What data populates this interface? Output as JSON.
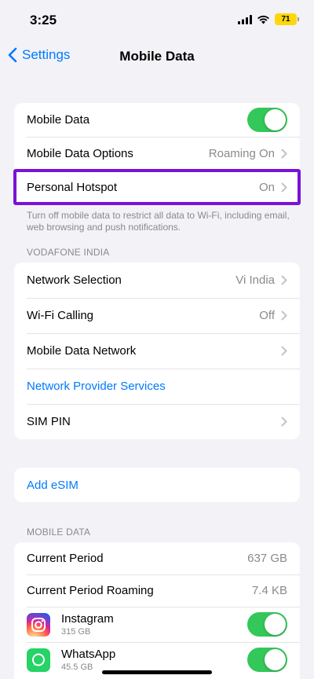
{
  "status": {
    "time": "3:25",
    "battery": "71"
  },
  "nav": {
    "back_label": "Settings",
    "title": "Mobile Data"
  },
  "group1": {
    "mobile_data_label": "Mobile Data",
    "options_label": "Mobile Data Options",
    "options_value": "Roaming On",
    "hotspot_label": "Personal Hotspot",
    "hotspot_value": "On"
  },
  "footnote": "Turn off mobile data to restrict all data to Wi-Fi, including email, web browsing and push notifications.",
  "carrier_header": "VODAFONE INDIA",
  "group2": {
    "network_selection_label": "Network Selection",
    "network_selection_value": "Vi India",
    "wifi_calling_label": "Wi-Fi Calling",
    "wifi_calling_value": "Off",
    "mobile_data_network_label": "Mobile Data Network",
    "provider_services_label": "Network Provider Services",
    "sim_pin_label": "SIM PIN"
  },
  "esim": {
    "label": "Add eSIM"
  },
  "usage_header": "MOBILE DATA",
  "usage": {
    "current_period_label": "Current Period",
    "current_period_value": "637 GB",
    "roaming_label": "Current Period Roaming",
    "roaming_value": "7.4 KB",
    "apps": [
      {
        "name": "Instagram",
        "size": "315 GB"
      },
      {
        "name": "WhatsApp",
        "size": "45.5 GB"
      }
    ]
  },
  "colors": {
    "accent": "#007aff",
    "toggle_on": "#34c759",
    "highlight": "#7b12d6"
  }
}
